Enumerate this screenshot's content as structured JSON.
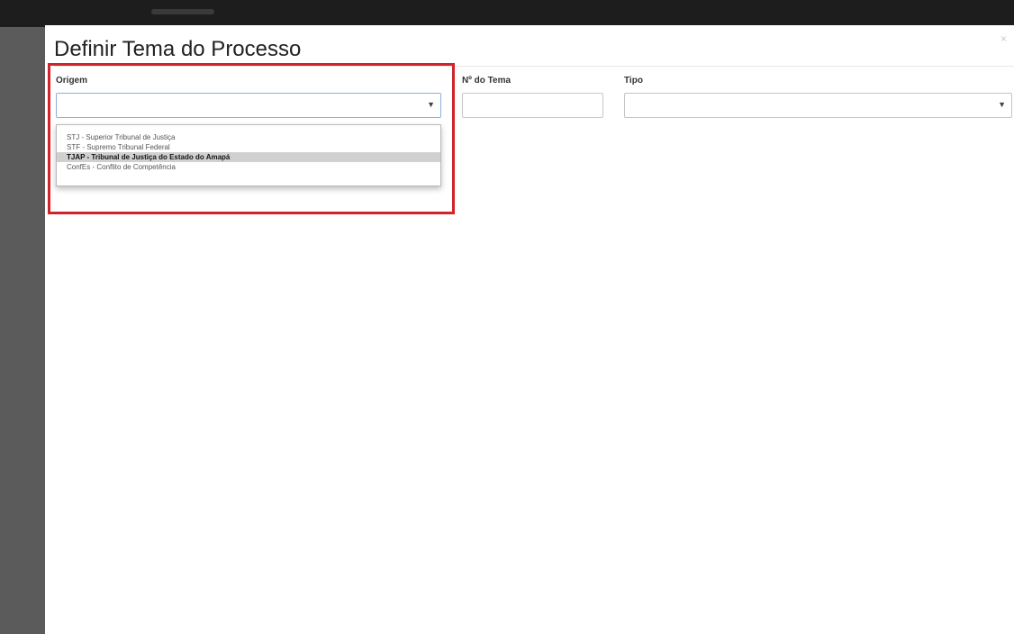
{
  "modal": {
    "title": "Definir Tema do Processo",
    "close_glyph": "×"
  },
  "fields": {
    "origem": {
      "label": "Origem",
      "value": "",
      "options": [
        "STJ - Superior Tribunal de Justiça",
        "STF - Supremo Tribunal Federal",
        "TJAP - Tribunal de Justiça do Estado do Amapá",
        "ConfEs - Conflito de Competência"
      ],
      "highlighted_option": "TJAP - Tribunal de Justiça do Estado do Amapá"
    },
    "numero_tema": {
      "label": "Nº do Tema",
      "value": ""
    },
    "tipo": {
      "label": "Tipo",
      "value": ""
    }
  },
  "icons": {
    "close": "close-icon",
    "dropdown": "chevron-down-icon"
  },
  "colors": {
    "highlight_border": "#d2232a",
    "selected_option_bg": "#d0d0d0",
    "focus_border": "#8fb0da"
  }
}
